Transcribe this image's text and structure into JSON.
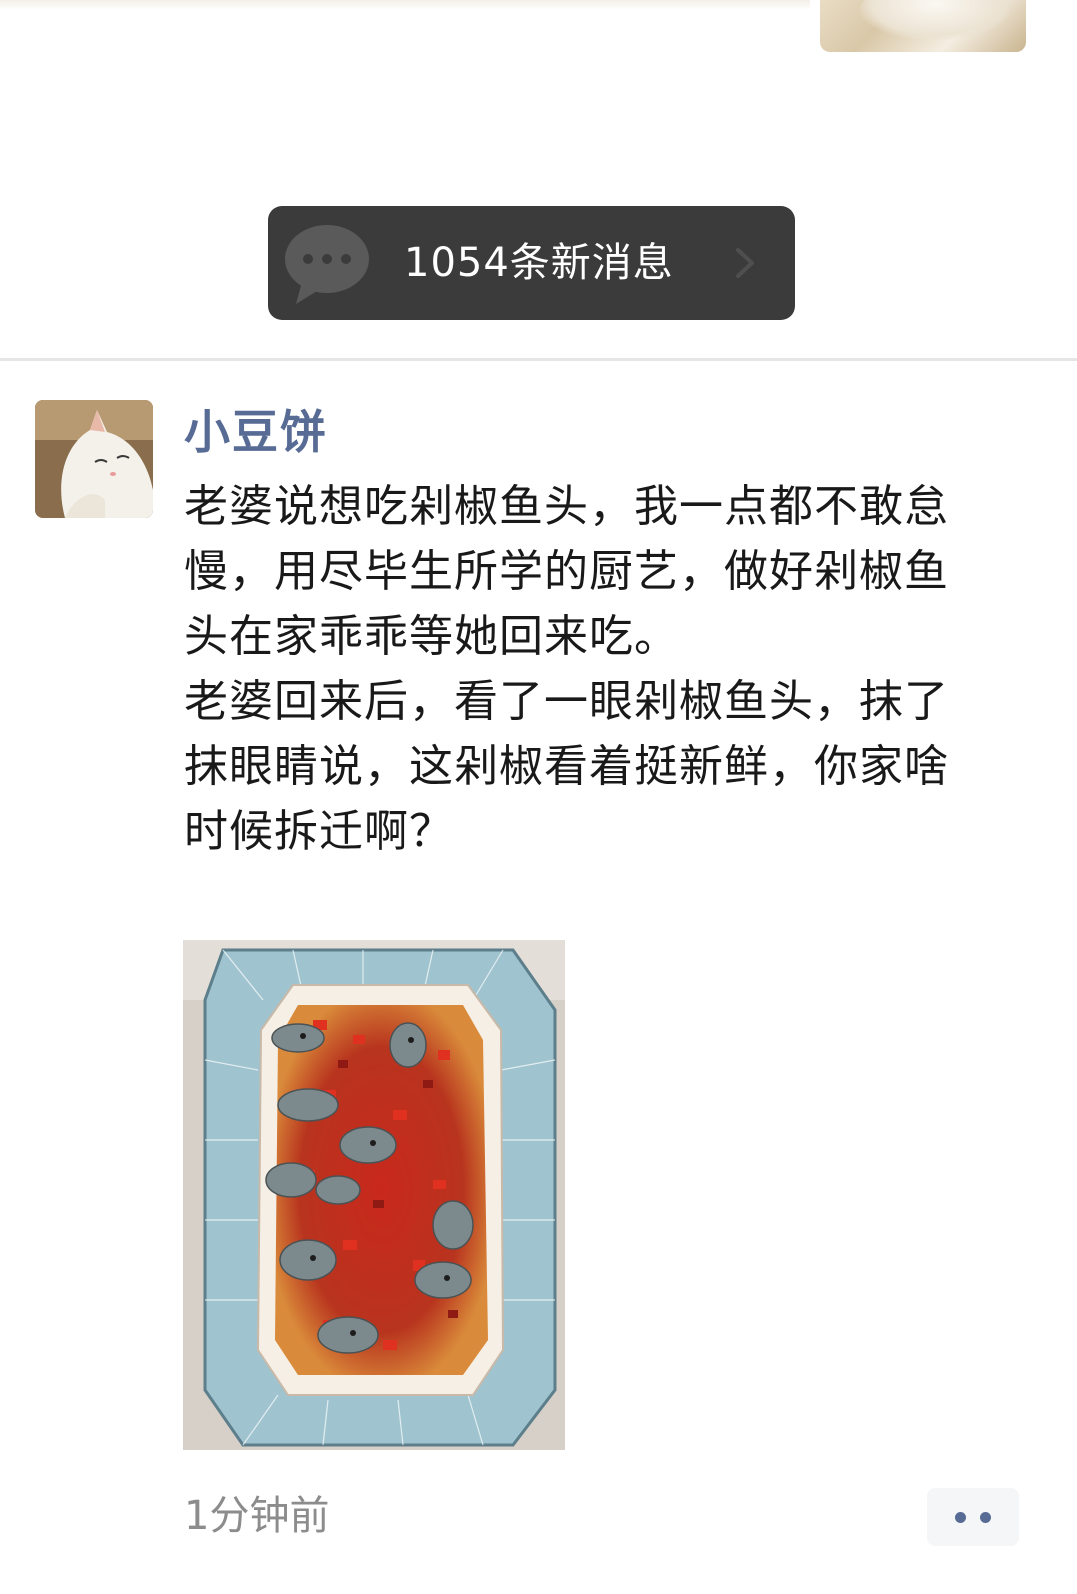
{
  "new_messages": {
    "label": "1054条新消息"
  },
  "post": {
    "author": "小豆饼",
    "paragraphs": [
      "老婆说想吃剁椒鱼头，我一点都不敢怠慢，用尽毕生所学的厨艺，做好剁椒鱼头在家乖乖等她回来吃。",
      "老婆回来后，看了一眼剁椒鱼头，抹了抹眼睛说，这剁椒看着挺新鲜，你家啥时候拆迁啊？"
    ],
    "time": "1分钟前"
  },
  "colors": {
    "author_name": "#576b95",
    "new_message_bar": "#3b3b3b",
    "body_text": "#191919",
    "time_text": "#8c8c8c"
  },
  "icons": {
    "new_message_icon": "chat-bubble-icon",
    "arrow": "chevron-right-icon",
    "more": "more-dots-icon"
  }
}
